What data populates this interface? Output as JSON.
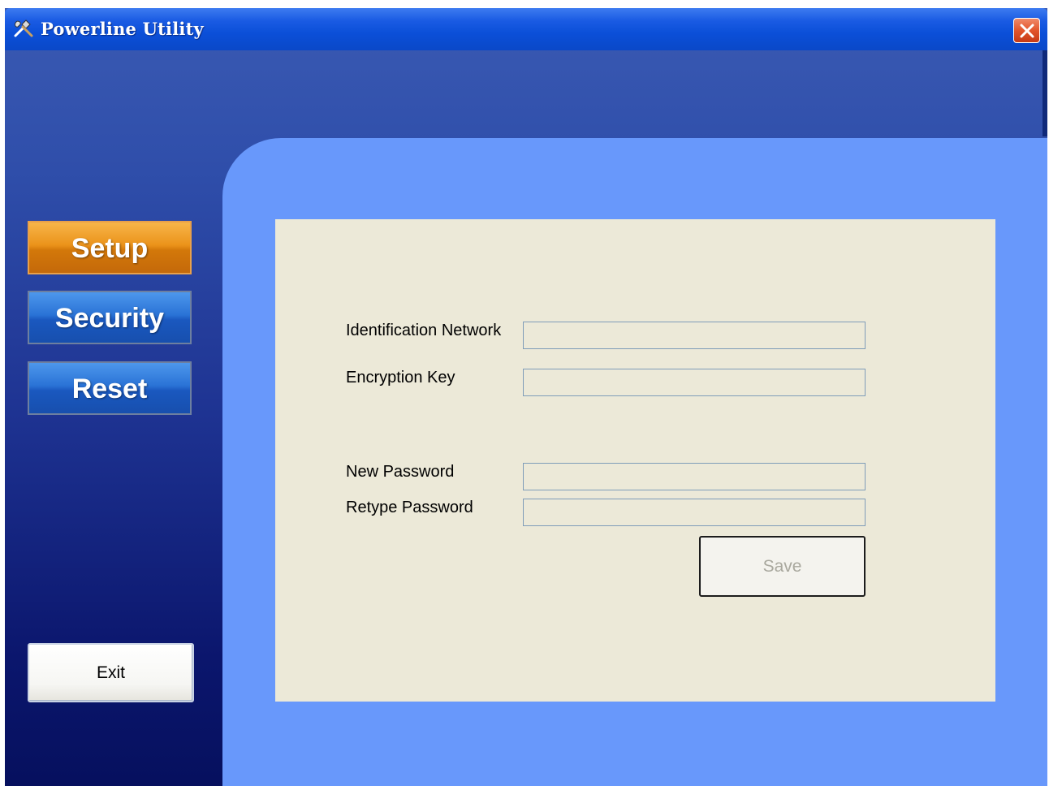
{
  "window": {
    "title": "Powerline Utility"
  },
  "sidebar": {
    "items": [
      {
        "label": "Setup",
        "active": true
      },
      {
        "label": "Security",
        "active": false
      },
      {
        "label": "Reset",
        "active": false
      }
    ],
    "exit_label": "Exit"
  },
  "form": {
    "fields": [
      {
        "label": "Identification Network",
        "value": ""
      },
      {
        "label": "Encryption Key",
        "value": ""
      },
      {
        "label": "New Password",
        "value": ""
      },
      {
        "label": "Retype Password",
        "value": ""
      }
    ],
    "save_label": "Save",
    "save_enabled": false
  },
  "colors": {
    "accent_active": "#eb931a",
    "nav_button": "#2a73d6",
    "content_panel": "#6898fb",
    "form_background": "#ece9d8"
  },
  "icons": {
    "app": "tools-icon",
    "close": "close-icon"
  }
}
